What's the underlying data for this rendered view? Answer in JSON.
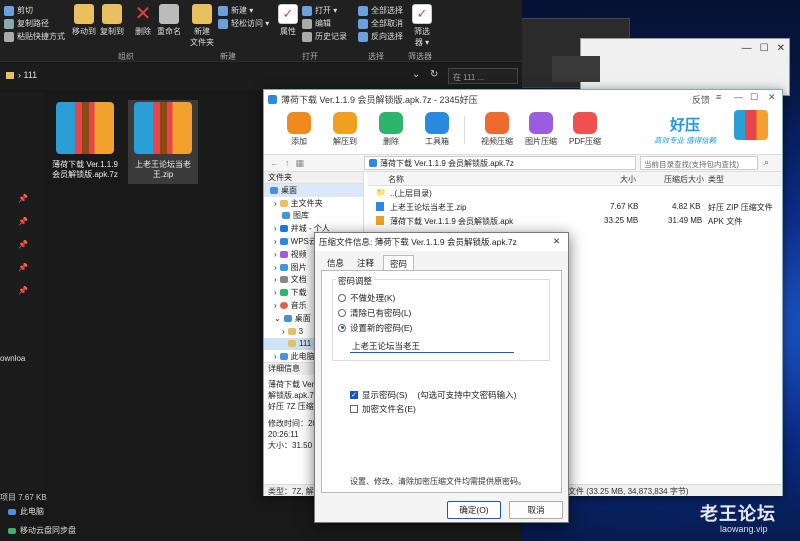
{
  "explorer": {
    "ribbon": {
      "clipboard": {
        "cut": "剪切",
        "copy_path": "复制路径",
        "paste_shortcut": "粘贴快捷方式"
      },
      "organize": {
        "label": "组织",
        "move_to": "移动到",
        "copy_to": "复制到",
        "delete": "删除",
        "rename": "重命名"
      },
      "new": {
        "label": "新建",
        "new_folder": "新建\n文件夹",
        "new_item": "新建 ▾",
        "easy_access": "轻松访问 ▾"
      },
      "open": {
        "label": "打开",
        "properties": "属性",
        "open": "打开 ▾",
        "edit": "编辑",
        "history": "历史记录"
      },
      "select": {
        "label": "选择",
        "select_all": "全部选择",
        "select_none": "全部取消",
        "invert": "反向选择"
      },
      "filter": {
        "label": "筛选器",
        "filter": "筛选\n器 ▾"
      }
    },
    "address": {
      "path": "111",
      "search_placeholder": "在 111 ..."
    },
    "files": [
      {
        "name": "薄荷下载 Ver.1.1.9 会员解锁版.apk.7z"
      },
      {
        "name": "上老王论坛当老王.zip"
      }
    ],
    "side_label": "ownloa",
    "status": "项目 7.67 KB",
    "nav": [
      "此电脑",
      "移动云盘同步盘"
    ]
  },
  "app": {
    "title": "薄荷下载 Ver.1.1.9 会员解锁版.apk.7z - 2345好压",
    "feedback": "反馈",
    "toolbar": [
      {
        "label": "添加",
        "color": "#f08a1c"
      },
      {
        "label": "解压到",
        "color": "#f0a020"
      },
      {
        "label": "删除",
        "color": "#2fb56b"
      },
      {
        "label": "工具箱",
        "color": "#2a8ae0"
      },
      {
        "label": "视频压缩",
        "color": "#f06a30"
      },
      {
        "label": "图片压缩",
        "color": "#9b5de0"
      },
      {
        "label": "PDF压缩",
        "color": "#f05050"
      }
    ],
    "brand": {
      "name": "好压",
      "slogan": "高效专业 值得信赖"
    },
    "path": "薄荷下载 Ver.1.1.9 会员解锁版.apk.7z",
    "search_placeholder": "当前目录查找(支持包内查找)",
    "tree_header": "文件夹",
    "tree": [
      "桌面",
      "主文件夹",
      "图库",
      "井城 - 个人",
      "WPS云",
      "视频",
      "图片",
      "文档",
      "下载",
      "音乐",
      "桌面",
      "3",
      "111",
      "此电脑"
    ],
    "details": {
      "header": "详细信息",
      "name": "薄荷下载 Ver.1.1.9 会员解锁版.apk.7z",
      "type": "好压 7Z 压缩文件",
      "modified_label": "修改时间：20",
      "time": "20:26:11",
      "size": "大小：31.50"
    },
    "columns": {
      "name": "名称",
      "size": "大小",
      "packed": "压缩后大小",
      "type": "类型"
    },
    "rows": [
      {
        "name": "..(上层目录)",
        "size": "",
        "packed": "",
        "type": ""
      },
      {
        "name": "上老王论坛当老王.zip",
        "size": "7.67 KB",
        "packed": "4.82 KB",
        "type": "好压 ZIP 压缩文件"
      },
      {
        "name": "薄荷下载 Ver.1.1.9 会员解锁版.apk",
        "size": "33.25 MB",
        "packed": "31.49 MB",
        "type": "APK 文件"
      }
    ],
    "status_left": "类型：7Z, 解",
    "status_right": "文件 (33.25 MB, 34,873,834 字节)"
  },
  "dialog": {
    "title": "压缩文件信息: 薄荷下载 Ver.1.1.9 会员解锁版.apk.7z",
    "tabs": [
      "信息",
      "注释",
      "密码"
    ],
    "group": "密码调整",
    "options": [
      "不做处理(K)",
      "清除已有密码(L)",
      "设置新的密码(E)"
    ],
    "password": "上老王论坛当老王",
    "show_password": "显示密码(S)",
    "show_password_hint": "(勾选可支持中文密码输入)",
    "encrypt_names": "加密文件名(E)",
    "note": "设置、修改、清除加密压缩文件均需提供原密码。",
    "ok": "确定(O)",
    "cancel": "取消"
  },
  "watermark": {
    "text": "老王论坛",
    "url": "laowang.vip"
  }
}
